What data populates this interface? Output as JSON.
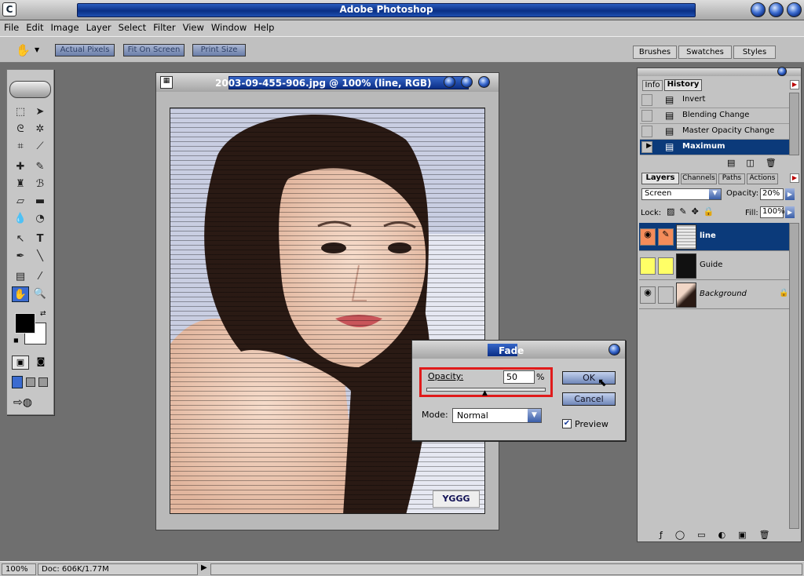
{
  "app": {
    "title": "Adobe Photoshop"
  },
  "menu": [
    "File",
    "Edit",
    "Image",
    "Layer",
    "Select",
    "Filter",
    "View",
    "Window",
    "Help"
  ],
  "options": {
    "actual_pixels": "Actual Pixels",
    "fit_on_screen": "Fit On Screen",
    "print_size": "Print Size"
  },
  "top_tabs": [
    "Brushes",
    "Swatches",
    "Styles"
  ],
  "document": {
    "title": "2003-09-455-906.jpg @ 100% (line, RGB)",
    "watermark": "YGGG"
  },
  "fade": {
    "title": "Fade",
    "opacity_label": "Opacity:",
    "opacity_value": "50",
    "opacity_unit": "%",
    "opacity_slider": 0.5,
    "mode_label": "Mode:",
    "mode_value": "Normal",
    "ok": "OK",
    "cancel": "Cancel",
    "preview": "Preview",
    "preview_checked": true
  },
  "history_panel": {
    "tabs": [
      "Info",
      "History"
    ],
    "items": [
      {
        "label": "Invert"
      },
      {
        "label": "Blending Change"
      },
      {
        "label": "Master Opacity Change"
      },
      {
        "label": "Maximum",
        "selected": true
      }
    ]
  },
  "layers_panel": {
    "tabs": [
      "Layers",
      "Channels",
      "Paths",
      "Actions"
    ],
    "blend_mode": "Screen",
    "opacity_label": "Opacity:",
    "opacity_value": "20%",
    "lock_label": "Lock:",
    "fill_label": "Fill:",
    "fill_value": "100%",
    "layers": [
      {
        "name": "line",
        "selected": true,
        "visible": true
      },
      {
        "name": "Guide",
        "selected": false,
        "visible": false
      },
      {
        "name": "Background",
        "selected": false,
        "visible": true,
        "locked": true
      }
    ]
  },
  "status": {
    "zoom": "100%",
    "doc": "Doc: 606K/1.77M"
  },
  "colors": {
    "selection_blue": "#0b3a7a",
    "accent_red": "#e01a1a",
    "layer_orange": "#f48c5a",
    "layer_yellow": "#ffff66"
  }
}
